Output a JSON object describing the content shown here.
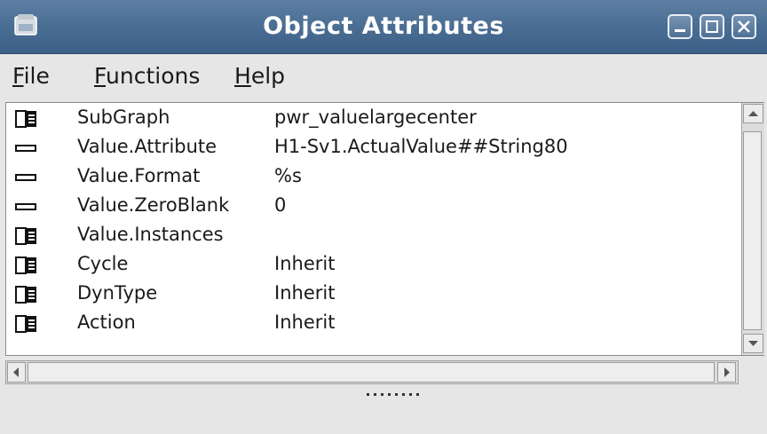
{
  "window": {
    "title": "Object Attributes",
    "icon": "app-window-icon",
    "controls": [
      "minimize-icon",
      "maximize-icon",
      "close-icon"
    ]
  },
  "menu": {
    "items": [
      {
        "mnemonic": "F",
        "rest": "ile"
      },
      {
        "mnemonic": "F",
        "rest": "unctions"
      },
      {
        "mnemonic": "H",
        "rest": "elp"
      }
    ]
  },
  "attributes": [
    {
      "icon": "folder-icon",
      "name": "SubGraph",
      "value": "pwr_valuelargecenter"
    },
    {
      "icon": "leaf-icon",
      "name": "Value.Attribute",
      "value": "H1-Sv1.ActualValue##String80"
    },
    {
      "icon": "leaf-icon",
      "name": "Value.Format",
      "value": "%s"
    },
    {
      "icon": "leaf-icon",
      "name": "Value.ZeroBlank",
      "value": "0"
    },
    {
      "icon": "folder-icon",
      "name": "Value.Instances",
      "value": ""
    },
    {
      "icon": "folder-icon",
      "name": "Cycle",
      "value": "Inherit"
    },
    {
      "icon": "folder-icon",
      "name": "DynType",
      "value": "Inherit"
    },
    {
      "icon": "folder-icon",
      "name": "Action",
      "value": "Inherit"
    }
  ],
  "colors": {
    "titlebar": "#4a6d93",
    "window_bg": "#e6e6e6",
    "list_bg": "#ffffff"
  }
}
